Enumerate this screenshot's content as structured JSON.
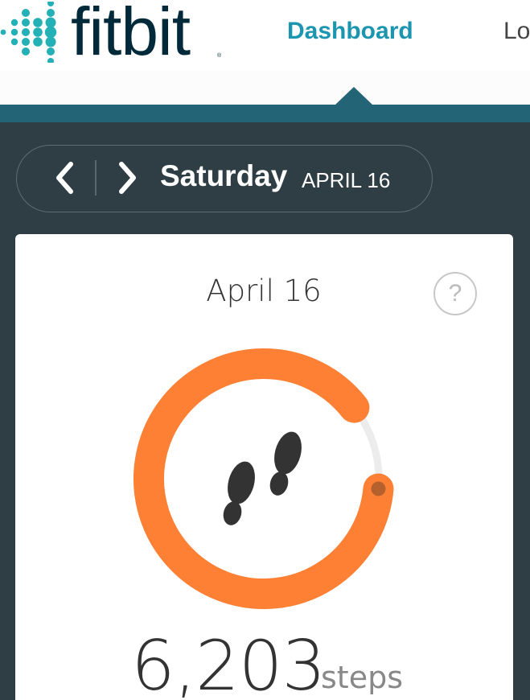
{
  "header": {
    "logo_text": "fitbit",
    "logo_registered": "®",
    "nav": {
      "dashboard": "Dashboard",
      "log": "Log"
    }
  },
  "date_selector": {
    "prev_icon": "chevron-left-icon",
    "next_icon": "chevron-right-icon",
    "day": "Saturday",
    "date": "APRIL 16"
  },
  "steps_card": {
    "date": "April 16",
    "help_label": "?",
    "icon": "footsteps-icon",
    "steps_value": "6,203",
    "steps_unit": "steps",
    "progress": 0.88
  },
  "colors": {
    "brand_teal": "#1c96b0",
    "logo_dots": "#23b0b7",
    "accent_bar": "#246477",
    "background": "#2f3e44",
    "ring_orange": "#fe8034",
    "ring_track": "#ececec"
  }
}
